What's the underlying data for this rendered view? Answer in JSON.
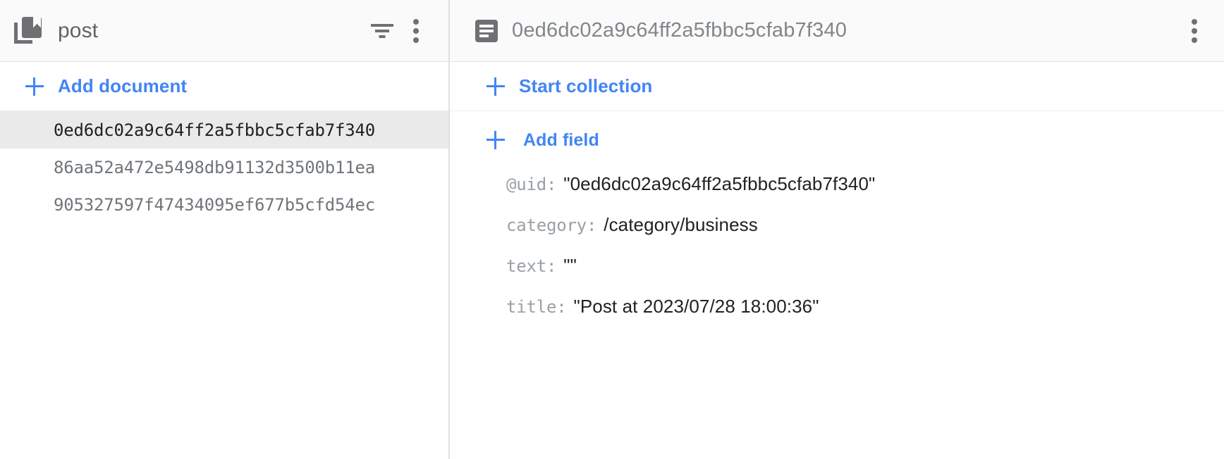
{
  "collection_panel": {
    "header": {
      "icon": "collection-icon",
      "title": "post",
      "filter_icon": "filter-icon",
      "menu_icon": "more-vert-icon"
    },
    "add_document_label": "Add document",
    "add_document_icon": "plus-icon",
    "documents": [
      {
        "id": "0ed6dc02a9c64ff2a5fbbc5cfab7f340",
        "selected": true
      },
      {
        "id": "86aa52a472e5498db91132d3500b11ea",
        "selected": false
      },
      {
        "id": "905327597f47434095ef677b5cfd54ec",
        "selected": false
      }
    ]
  },
  "document_panel": {
    "header": {
      "icon": "document-icon",
      "title": "0ed6dc02a9c64ff2a5fbbc5cfab7f340",
      "menu_icon": "more-vert-icon"
    },
    "start_collection_label": "Start collection",
    "start_collection_icon": "plus-icon",
    "add_field_label": "Add field",
    "add_field_icon": "plus-icon",
    "fields": [
      {
        "key": "@uid:",
        "value": "\"0ed6dc02a9c64ff2a5fbbc5cfab7f340\""
      },
      {
        "key": "category:",
        "value": "/category/business"
      },
      {
        "key": "text:",
        "value": "\"\""
      },
      {
        "key": "title:",
        "value": "\"Post at 2023/07/28 18:00:36\""
      }
    ]
  },
  "colors": {
    "accent_blue": "#4285f4",
    "icon_gray": "#6e7073",
    "key_gray": "#9aa0a6",
    "selected_row_bg": "#eaeaea",
    "header_bg": "#fafafa",
    "border": "#e0e0e0"
  }
}
